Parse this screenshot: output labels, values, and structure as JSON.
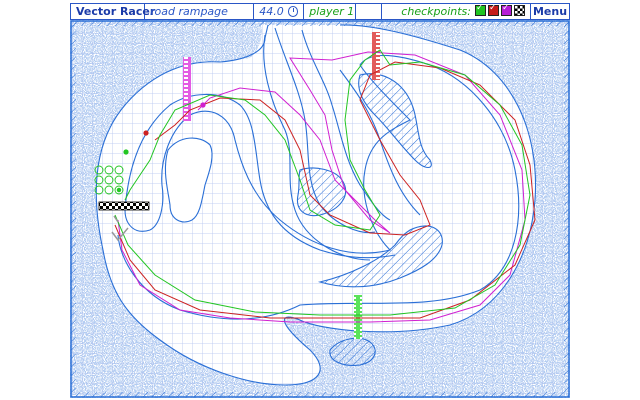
{
  "header": {
    "title": "Vector Racer",
    "track_name": "road rampage",
    "time": "44.0",
    "player": "player 1",
    "checkpoints_label": "checkpoints:",
    "checkpoints": [
      {
        "color": "#21c421",
        "done": true
      },
      {
        "color": "#c41b1b",
        "done": true
      },
      {
        "color": "#b51bd6",
        "done": true
      },
      {
        "color": "checkered",
        "done": false
      }
    ],
    "menu_label": "Menu"
  },
  "colors": {
    "grid": "#b4c3ef",
    "track": "#2a6fd6",
    "green_line": "#22c522",
    "red_line": "#cc2222",
    "magenta_line": "#d020d0",
    "cp_green": "#5be35b",
    "cp_red": "#e25b5b",
    "cp_magenta": "#e35be3"
  }
}
